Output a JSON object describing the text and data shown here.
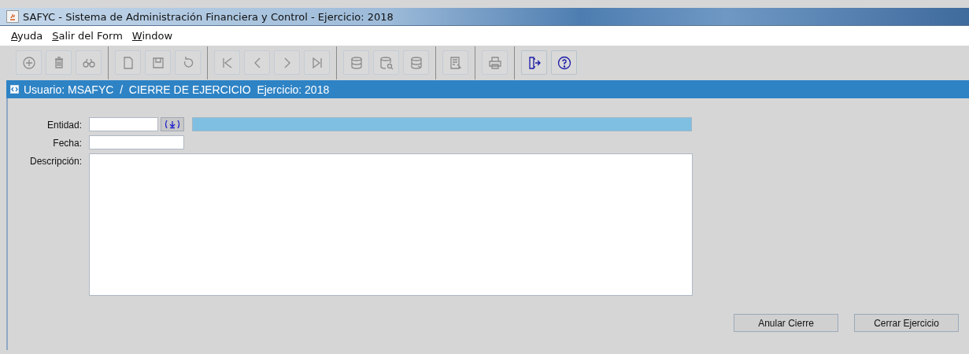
{
  "window": {
    "title": "SAFYC - Sistema de Administración Financiera y Control - Ejercicio: 2018"
  },
  "menu": [
    {
      "label": "Ayuda"
    },
    {
      "label": "Salir del Form"
    },
    {
      "label": "Window"
    }
  ],
  "toolbar": [
    [
      {
        "kind": "add",
        "disabled": true
      },
      {
        "kind": "delete",
        "disabled": true
      },
      {
        "kind": "find",
        "disabled": true
      }
    ],
    [
      {
        "kind": "new",
        "disabled": true
      },
      {
        "kind": "save",
        "disabled": true
      },
      {
        "kind": "undo",
        "disabled": true
      }
    ],
    [
      {
        "kind": "first",
        "disabled": true
      },
      {
        "kind": "prev",
        "disabled": true
      },
      {
        "kind": "next",
        "disabled": true
      },
      {
        "kind": "last",
        "disabled": true
      }
    ],
    [
      {
        "kind": "query",
        "disabled": true
      },
      {
        "kind": "search",
        "disabled": true
      },
      {
        "kind": "execute",
        "disabled": true
      }
    ],
    [
      {
        "kind": "report",
        "disabled": true
      }
    ],
    [
      {
        "kind": "print",
        "disabled": true
      }
    ],
    [
      {
        "kind": "exit",
        "disabled": false
      },
      {
        "kind": "help",
        "disabled": false
      }
    ]
  ],
  "form_header": {
    "title": "Usuario: MSAFYC  /  CIERRE DE EJERCICIO  Ejercicio: 2018"
  },
  "fields": [
    {
      "label": "Entidad:",
      "kind": "lov"
    },
    {
      "label": "Fecha:",
      "kind": "date"
    },
    {
      "label": "Descripción:",
      "kind": "text"
    }
  ],
  "buttons": [
    {
      "label": "Anular Cierre"
    },
    {
      "label": "Cerrar Ejercicio"
    }
  ]
}
